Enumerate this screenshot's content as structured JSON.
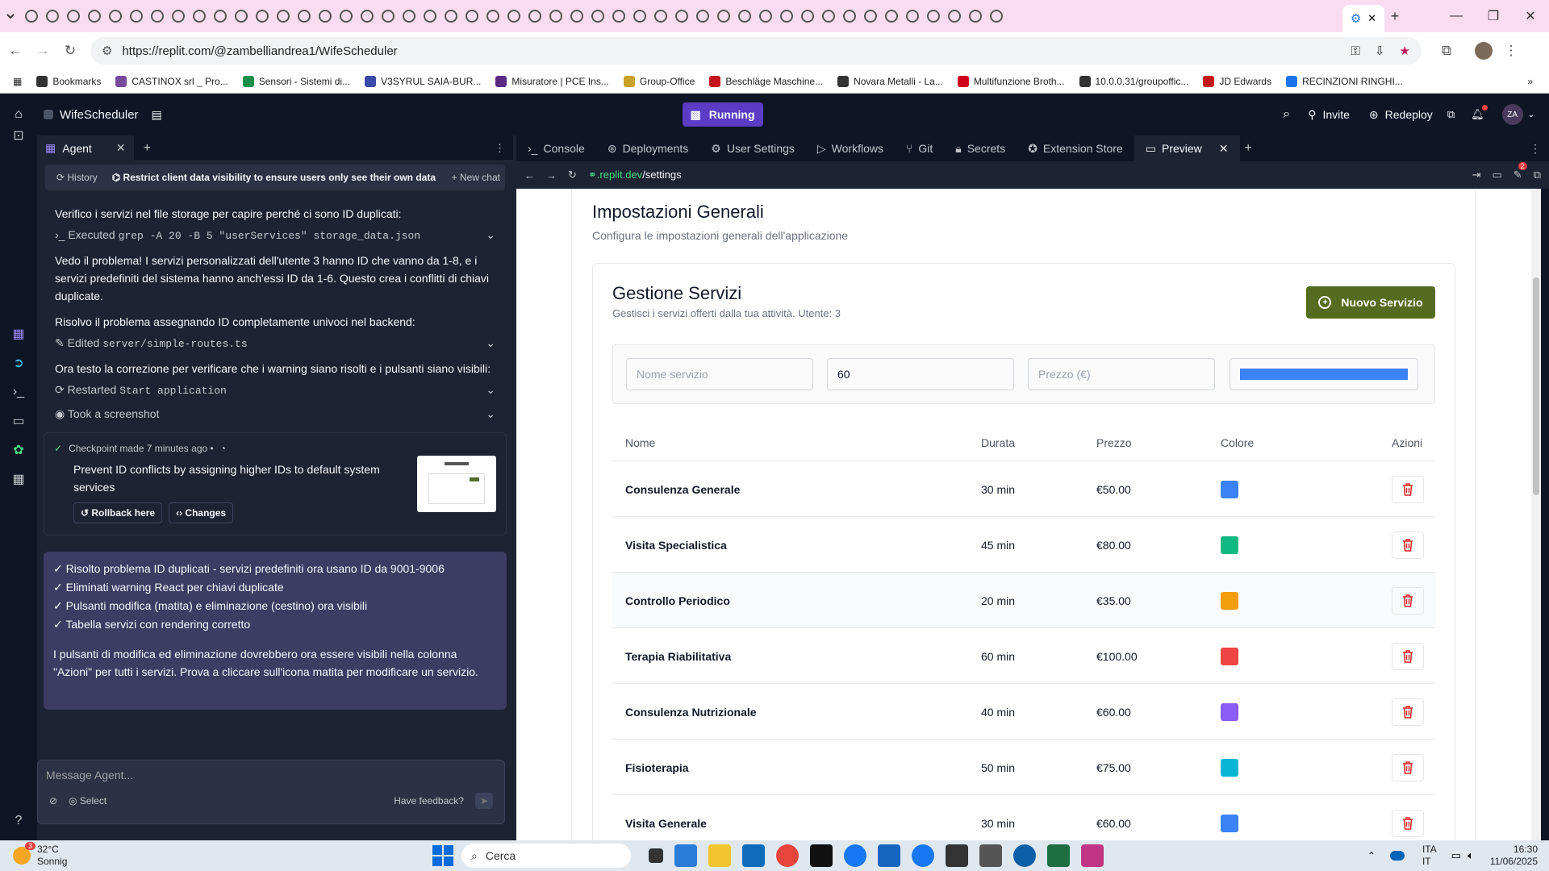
{
  "browser": {
    "url": "https://replit.com/@zambelliandrea1/WifeScheduler",
    "bookmarks": [
      "Bookmarks",
      "CASTINOX srl _ Pro...",
      "Sensori - Sistemi di...",
      "V3SYRUL SAIA-BUR...",
      "Misuratore | PCE Ins...",
      "Group-Office",
      "Beschläge Maschine...",
      "Novara Metalli - La...",
      "Multifunzione Broth...",
      "10.0.0.31/groupoffic...",
      "JD Edwards",
      "RECINZIONI RINGHI..."
    ],
    "bookmark_colors": [
      "#333333",
      "#7a4b9b",
      "#1a8f4a",
      "#3a4aa8",
      "#5b2a86",
      "#c9a227",
      "#c4161c",
      "#333333",
      "#d0021b",
      "#333333",
      "#c4161c",
      "#1a73e8"
    ]
  },
  "replit": {
    "project_name": "WifeScheduler",
    "run_status": "Running",
    "invite_label": "Invite",
    "redeploy_label": "Redeploy",
    "avatar_initials": "ZA",
    "notification_count": "2"
  },
  "agent": {
    "tab_label": "Agent",
    "history_label": "History",
    "chat_title": "Restrict client data visibility to ensure users only see their own data",
    "new_chat_label": "New chat",
    "msg1": "Verifico i servizi nel file storage per capire perché ci sono ID duplicati:",
    "tool1_prefix": "Executed",
    "tool1_cmd": "grep -A 20 -B 5 \"userServices\" storage_data.json",
    "msg2": "Vedo il problema! I servizi personalizzati dell'utente 3 hanno ID che vanno da 1-8, e i servizi predefiniti del sistema hanno anch'essi ID da 1-6. Questo crea i conflitti di chiavi duplicate.",
    "msg3": "Risolvo il problema assegnando ID completamente univoci nel backend:",
    "tool2_prefix": "Edited",
    "tool2_file": "server/simple-routes.ts",
    "msg4": "Ora testo la correzione per verificare che i warning siano risolti e i pulsanti siano visibili:",
    "tool3_prefix": "Restarted",
    "tool3_name": "Start application",
    "tool4": "Took a screenshot",
    "checkpoint_meta": "Checkpoint made 7 minutes ago  •",
    "checkpoint_text": "Prevent ID conflicts by assigning higher IDs to default system services",
    "rollback_label": "Rollback here",
    "changes_label": "Changes",
    "summary_items": [
      "✓ Risolto problema ID duplicati - servizi predefiniti ora usano ID da 9001-9006",
      "✓ Eliminati warning React per chiavi duplicate",
      "✓ Pulsanti modifica (matita) e eliminazione (cestino) ora visibili",
      "✓ Tabella servizi con rendering corretto"
    ],
    "summary_text": "I pulsanti di modifica ed eliminazione dovrebbero ora essere visibili nella colonna \"Azioni\" per tutti i servizi. Prova a cliccare sull'icona matita per modificare un servizio.",
    "input_placeholder": "Message Agent...",
    "select_label": "Select",
    "feedback_label": "Have feedback?"
  },
  "workspace": {
    "tabs": [
      "Console",
      "Deployments",
      "User Settings",
      "Workflows",
      "Git",
      "Secrets",
      "Extension Store",
      "Preview"
    ],
    "preview_url_host": ".replit.dev",
    "preview_url_path": "/settings"
  },
  "app": {
    "page_title": "Impostazioni Generali",
    "page_subtitle": "Configura le impostazioni generali dell'applicazione",
    "section_title": "Gestione Servizi",
    "section_subtitle": "Gestisci i servizi offerti dalla tua attività. Utente: 3",
    "new_service_label": "Nuovo Servizio",
    "form": {
      "name_placeholder": "Nome servizio",
      "duration_value": "60",
      "price_placeholder": "Prezzo (€)",
      "color_value": "#3b82f6"
    },
    "columns": [
      "Nome",
      "Durata",
      "Prezzo",
      "Colore",
      "Azioni"
    ],
    "services": [
      {
        "name": "Consulenza Generale",
        "duration": "30 min",
        "price": "€50.00",
        "color": "#3b82f6"
      },
      {
        "name": "Visita Specialistica",
        "duration": "45 min",
        "price": "€80.00",
        "color": "#10b981"
      },
      {
        "name": "Controllo Periodico",
        "duration": "20 min",
        "price": "€35.00",
        "color": "#f59e0b"
      },
      {
        "name": "Terapia Riabilitativa",
        "duration": "60 min",
        "price": "€100.00",
        "color": "#ef4444"
      },
      {
        "name": "Consulenza Nutrizionale",
        "duration": "40 min",
        "price": "€60.00",
        "color": "#8b5cf6"
      },
      {
        "name": "Fisioterapia",
        "duration": "50 min",
        "price": "€75.00",
        "color": "#06b6d4"
      },
      {
        "name": "Visita Generale",
        "duration": "30 min",
        "price": "€60.00",
        "color": "#3b82f6"
      }
    ]
  },
  "taskbar": {
    "weather_temp": "32°C",
    "weather_desc": "Sonnig",
    "weather_badge": "3",
    "search_label": "Cerca",
    "lang": "ITA",
    "region": "IT",
    "time": "16:30",
    "date": "11/06/2025"
  }
}
